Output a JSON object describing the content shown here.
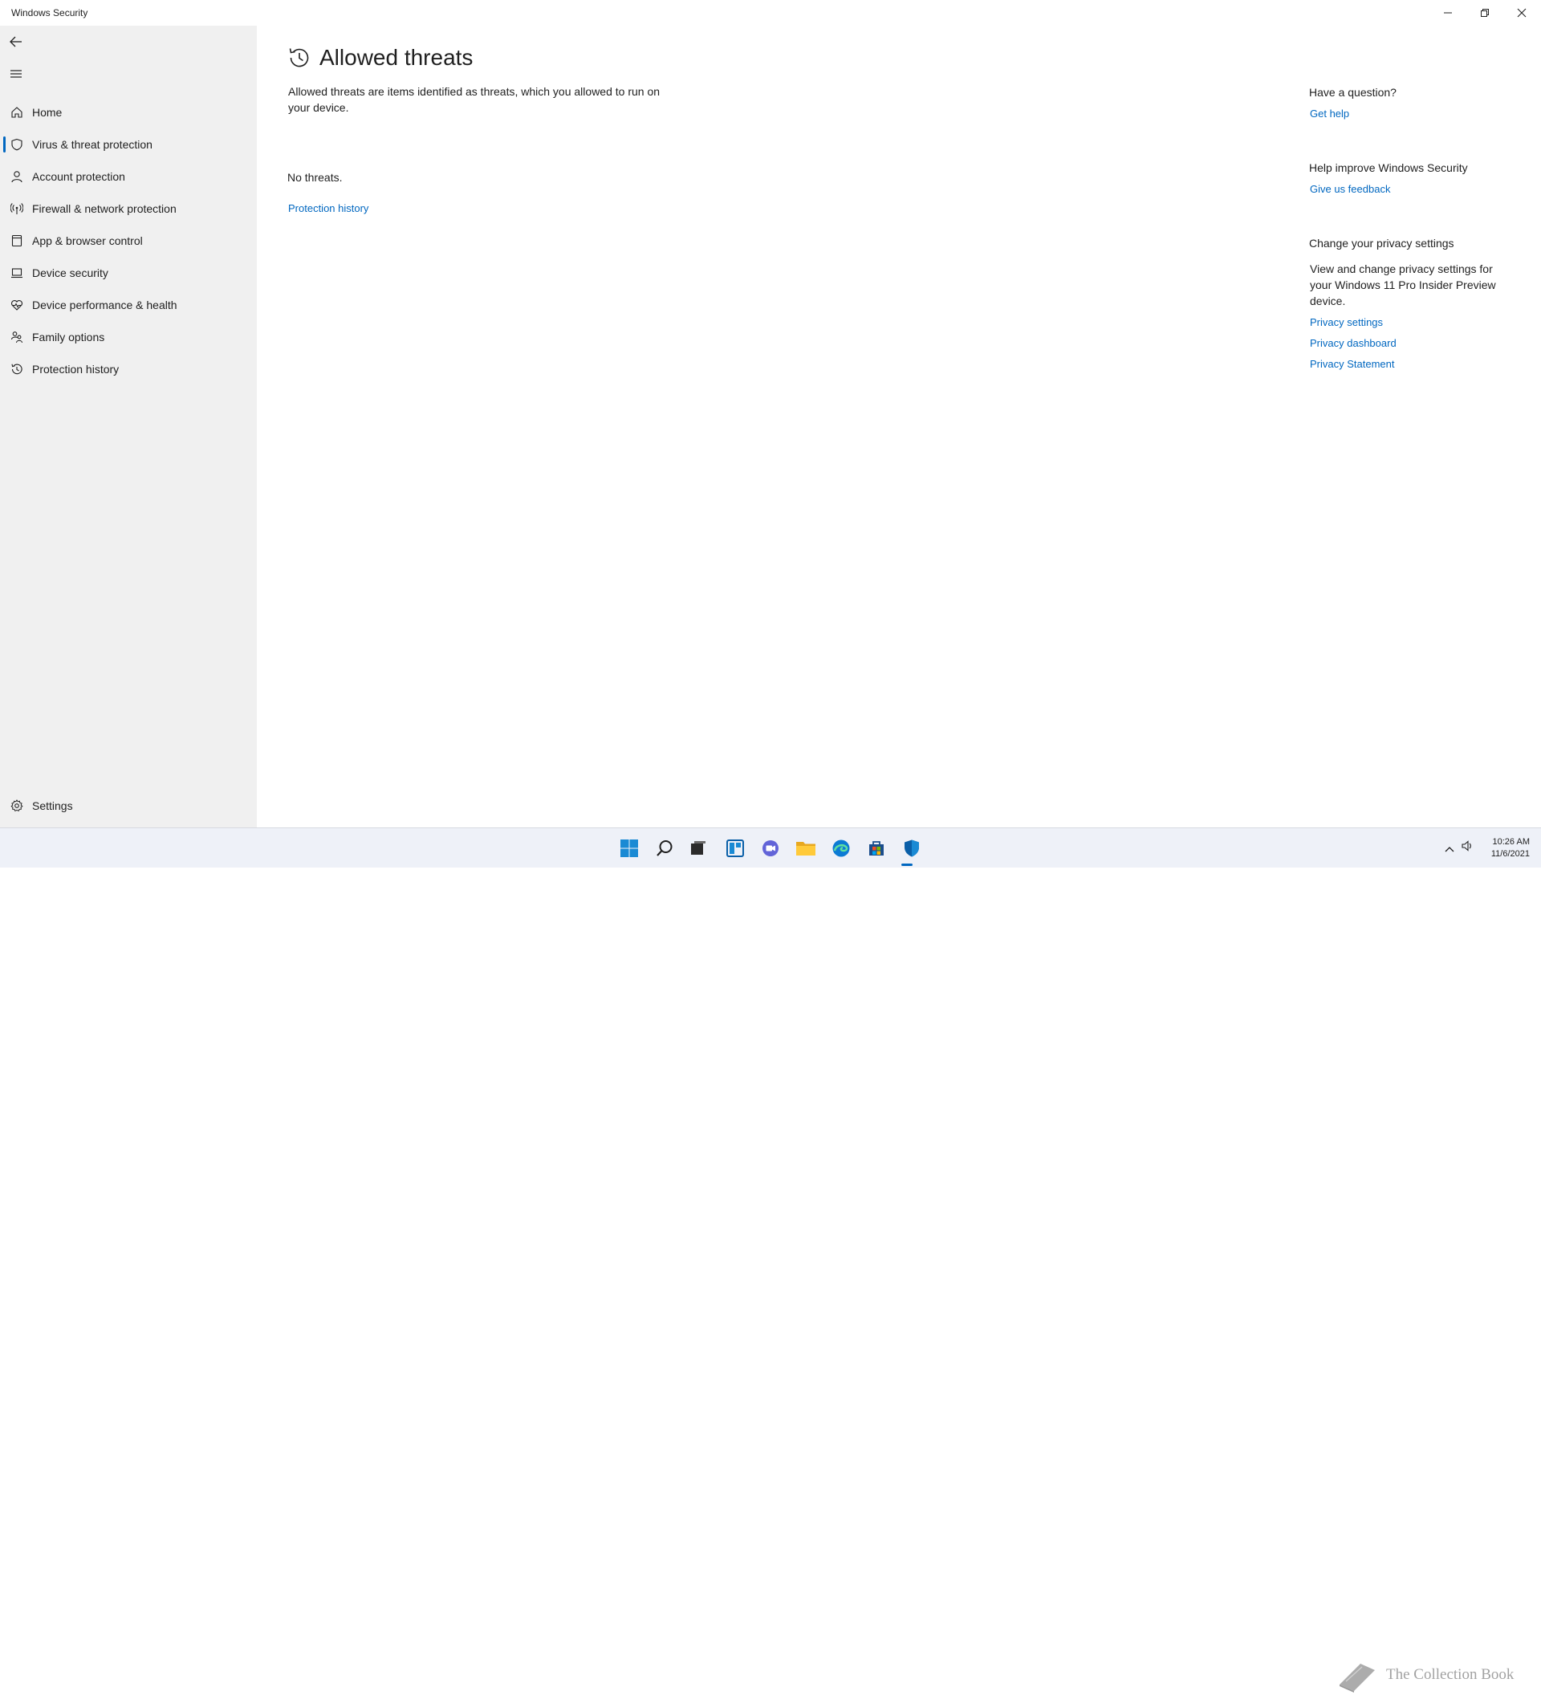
{
  "window": {
    "title": "Windows Security"
  },
  "sidebar": {
    "items": [
      {
        "label": "Home",
        "icon": "home-icon"
      },
      {
        "label": "Virus & threat protection",
        "icon": "shield-icon"
      },
      {
        "label": "Account protection",
        "icon": "person-icon"
      },
      {
        "label": "Firewall & network protection",
        "icon": "wireless-icon"
      },
      {
        "label": "App & browser control",
        "icon": "app-window-icon"
      },
      {
        "label": "Device security",
        "icon": "laptop-icon"
      },
      {
        "label": "Device performance & health",
        "icon": "heart-pulse-icon"
      },
      {
        "label": "Family options",
        "icon": "family-icon"
      },
      {
        "label": "Protection history",
        "icon": "history-icon"
      }
    ],
    "active_index": 1,
    "settings_label": "Settings"
  },
  "main": {
    "title": "Allowed threats",
    "description": "Allowed threats are items identified as threats, which you allowed to run on your device.",
    "empty_text": "No threats.",
    "history_link": "Protection history"
  },
  "rhs": {
    "question_heading": "Have a question?",
    "get_help": "Get help",
    "improve_heading": "Help improve Windows Security",
    "feedback": "Give us feedback",
    "privacy_heading": "Change your privacy settings",
    "privacy_text": "View and change privacy settings for your Windows 11 Pro Insider Preview device.",
    "privacy_settings": "Privacy settings",
    "privacy_dashboard": "Privacy dashboard",
    "privacy_statement": "Privacy Statement"
  },
  "taskbar": {
    "time": "10:26 AM",
    "date": "11/6/2021",
    "watermark": "The Collection Book"
  },
  "colors": {
    "accent": "#0067c0",
    "sidebar_bg": "#f0f0f0"
  }
}
